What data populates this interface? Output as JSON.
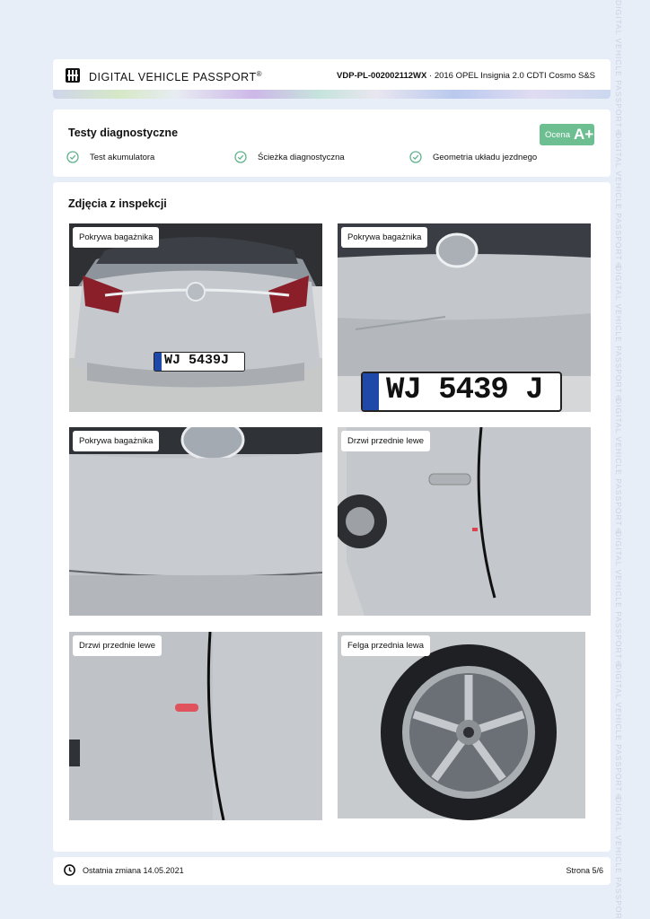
{
  "watermark": "DIGITAL VEHICLE PASSPORT®",
  "header": {
    "brand": "DIGITAL VEHICLE PASSPORT",
    "brand_mark": "®",
    "vdp_id": "VDP-PL-002002112WX",
    "vehicle": " · 2016 OPEL Insignia 2.0 CDTI Cosmo S&S"
  },
  "diagnostics": {
    "title": "Testy diagnostyczne",
    "grade_label": "Ocena",
    "grade_value": "A+",
    "tests": [
      {
        "label": "Test akumulatora",
        "status": "passed"
      },
      {
        "label": "Ścieżka diagnostyczna",
        "status": "passed"
      },
      {
        "label": "Geometria układu jezdnego",
        "status": "passed"
      }
    ]
  },
  "photos": {
    "title": "Zdjęcia z inspekcji",
    "items": [
      {
        "label": "Pokrywa bagażnika",
        "plate": "WJ 5439J"
      },
      {
        "label": "Pokrywa bagażnika",
        "plate": "WJ 5439 J"
      },
      {
        "label": "Pokrywa bagażnika"
      },
      {
        "label": "Drzwi przednie lewe"
      },
      {
        "label": "Drzwi przednie lewe"
      },
      {
        "label": "Felga przednia lewa"
      }
    ]
  },
  "footer": {
    "last_change": "Ostatnia zmiana 14.05.2021",
    "page": "Strona 5/6"
  },
  "colors": {
    "background": "#e8eef8",
    "grade_green": "#6dbf92",
    "check_green": "#5fb38a"
  },
  "icons": {
    "logo": "passport-logo-icon",
    "check": "check-circle-icon",
    "clock": "clock-icon"
  }
}
